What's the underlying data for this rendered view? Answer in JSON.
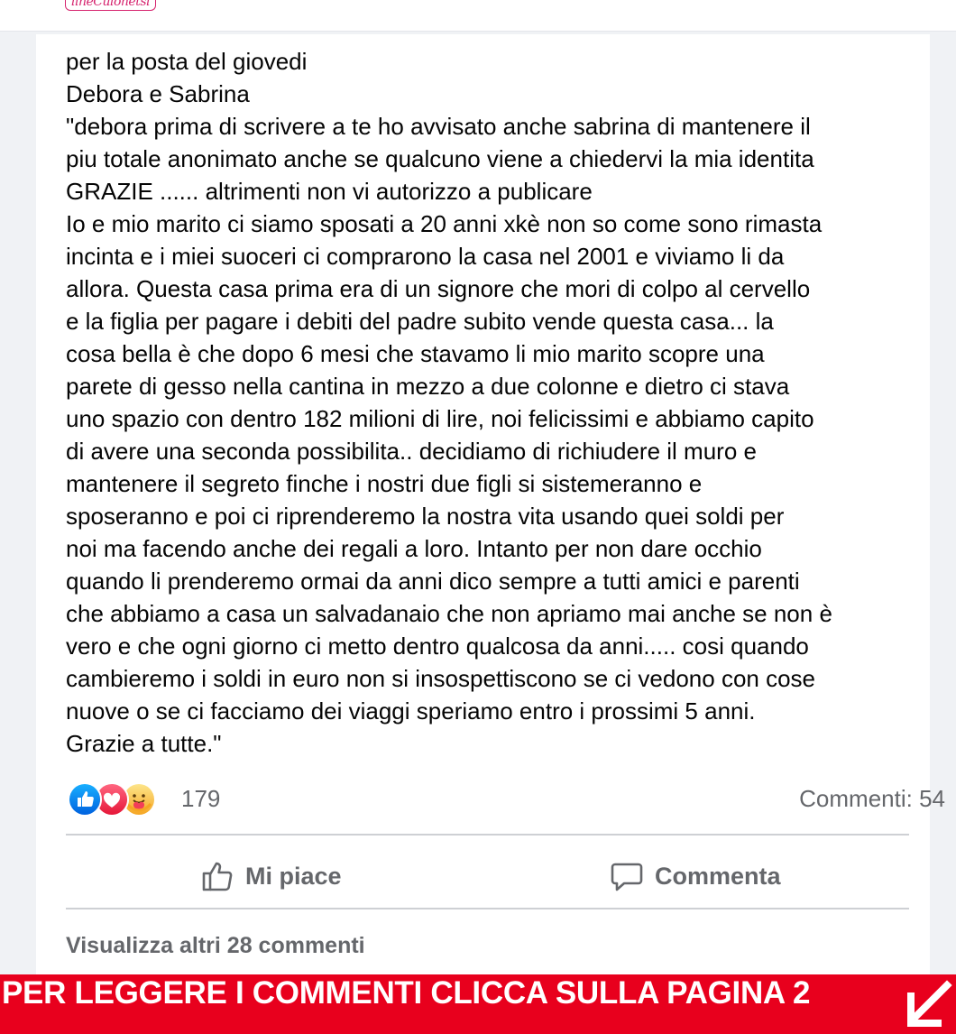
{
  "header": {
    "logo_text": "lineCulonetsi"
  },
  "post": {
    "lines": [
      "per la posta del giovedi",
      "Debora e Sabrina",
      "\"debora prima di scrivere a te ho avvisato anche sabrina di mantenere il",
      "piu totale anonimato anche se qualcuno viene a chiedervi la mia identita",
      "GRAZIE ...... altrimenti non vi autorizzo a publicare",
      "Io e mio marito ci siamo sposati a 20 anni xkè non so come sono rimasta",
      "incinta e i miei suoceri ci comprarono la casa nel 2001 e viviamo li da",
      "allora. Questa casa prima era di un signore che mori di colpo al cervello",
      "e la figlia per pagare i debiti del padre subito vende questa casa... la",
      "cosa bella è che dopo 6 mesi che stavamo li mio marito scopre una",
      "parete di gesso nella cantina in mezzo a due colonne e dietro ci stava",
      "uno spazio con dentro 182 milioni di lire, noi felicissimi e abbiamo capito",
      "di avere una seconda possibilita.. decidiamo di richiudere il muro e",
      "mantenere il segreto finche i nostri due figli si sistemeranno e",
      "sposeranno e poi ci riprenderemo la nostra vita usando quei soldi per",
      "noi ma facendo anche dei regali a loro. Intanto per non dare occhio",
      "quando li prenderemo ormai da anni dico sempre a tutti amici e parenti",
      "che abbiamo a casa un salvadanaio che non apriamo mai anche se non è",
      "vero e che ogni giorno ci metto dentro qualcosa da anni..... cosi quando",
      "cambieremo i soldi in euro non si insospettiscono se ci vedono con cose",
      "nuove o se ci facciamo dei viaggi speriamo entro i prossimi 5 anni.",
      "Grazie a tutte.\""
    ]
  },
  "reactions": {
    "icons": [
      "like-icon",
      "love-icon",
      "care-icon"
    ],
    "count": "179",
    "comments": "Commenti: 54"
  },
  "actions": {
    "like_label": "Mi piace",
    "comment_label": "Commenta"
  },
  "more_comments": "Visualizza altri 28 commenti",
  "banner": {
    "text": "PER LEGGERE I COMMENTI CLICCA SULLA PAGINA 2",
    "arrow_icon": "arrow-down-left-icon"
  },
  "colors": {
    "like_blue": "#1877f2",
    "love_red": "#f33e58",
    "care_yellow": "#f7b125",
    "banner_red": "#e8001d",
    "muted_text": "#65676b"
  }
}
